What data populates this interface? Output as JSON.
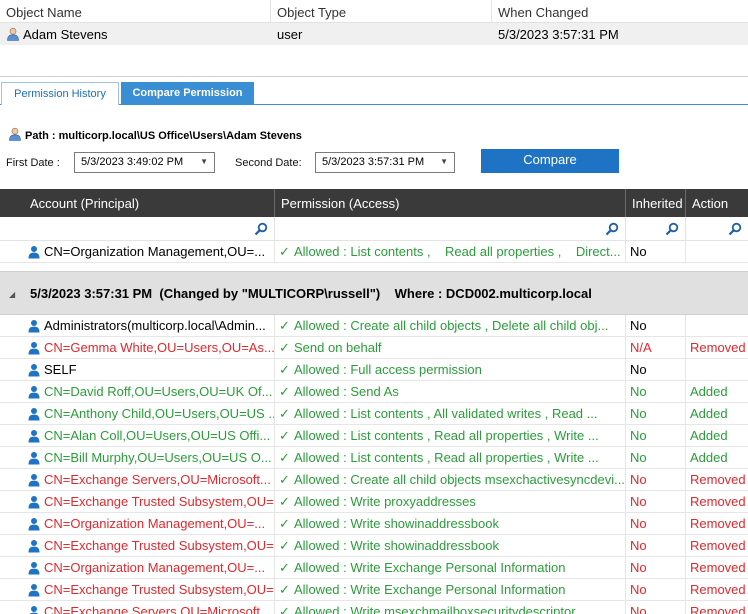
{
  "top_grid": {
    "headers": [
      "Object Name",
      "Object Type",
      "When Changed"
    ],
    "row": {
      "name": "Adam Stevens",
      "type": "user",
      "when": "5/3/2023 3:57:31 PM"
    }
  },
  "tabs": [
    {
      "label": "Permission History",
      "active": false
    },
    {
      "label": "Compare Permission",
      "active": true
    }
  ],
  "path": "Path : multicorp.local\\US Office\\Users\\Adam Stevens",
  "first_date": {
    "label": "First Date :",
    "value": "5/3/2023 3:49:02 PM"
  },
  "second_date": {
    "label": "Second Date:",
    "value": "5/3/2023 3:57:31 PM"
  },
  "compare_label": "Compare",
  "grid": {
    "headers": [
      "Account (Principal)",
      "Permission (Access)",
      "Inherited",
      "Action"
    ],
    "pre_rows": [
      {
        "account": "CN=Organization Management,OU=...",
        "perm_a": "Allowed : List contents ,",
        "perm_b": "Read all properties ,",
        "perm_c": "Direct...",
        "inherited": "No",
        "action": "",
        "color": "black"
      }
    ],
    "group_text": "5/3/2023 3:57:31 PM  (Changed by \"MULTICORP\\russell\")    Where : DCD002.multicorp.local",
    "rows": [
      {
        "account": "Administrators(multicorp.local\\Admin...",
        "perm": "Allowed : Create all child objects ,    Delete all child obj...",
        "inherited": "No",
        "action": "",
        "color": "black"
      },
      {
        "account": "CN=Gemma White,OU=Users,OU=As...",
        "perm": "Send on behalf",
        "inherited": "N/A",
        "action": "Removed",
        "color": "red"
      },
      {
        "account": "SELF",
        "perm": "Allowed : Full access permission",
        "inherited": "No",
        "action": "",
        "color": "black"
      },
      {
        "account": "CN=David Roff,OU=Users,OU=UK Of...",
        "perm": "Allowed : Send As",
        "inherited": "No",
        "action": "Added",
        "color": "green"
      },
      {
        "account": "CN=Anthony Child,OU=Users,OU=US ...",
        "perm": "Allowed : List contents ,    All validated writes ,    Read ...",
        "inherited": "No",
        "action": "Added",
        "color": "green"
      },
      {
        "account": "CN=Alan Coll,OU=Users,OU=US Offi...",
        "perm": "Allowed : List contents ,    Read all properties ,    Write ...",
        "inherited": "No",
        "action": "Added",
        "color": "green"
      },
      {
        "account": "CN=Bill Murphy,OU=Users,OU=US O...",
        "perm": "Allowed : List contents ,    Read all properties ,    Write ...",
        "inherited": "No",
        "action": "Added",
        "color": "green"
      },
      {
        "account": "CN=Exchange Servers,OU=Microsoft...",
        "perm": "Allowed : Create all child objects msexchactivesyncdevi...",
        "inherited": "No",
        "action": "Removed",
        "color": "red"
      },
      {
        "account": "CN=Exchange Trusted Subsystem,OU=...",
        "perm": "Allowed : Write   proxyaddresses",
        "inherited": "No",
        "action": "Removed",
        "color": "red"
      },
      {
        "account": "CN=Organization Management,OU=...",
        "perm": "Allowed : Write   showinaddressbook",
        "inherited": "No",
        "action": "Removed",
        "color": "red"
      },
      {
        "account": "CN=Exchange Trusted Subsystem,OU=...",
        "perm": "Allowed : Write   showinaddressbook",
        "inherited": "No",
        "action": "Removed",
        "color": "red"
      },
      {
        "account": "CN=Organization Management,OU=...",
        "perm": "Allowed : Write   Exchange Personal Information",
        "inherited": "No",
        "action": "Removed",
        "color": "red"
      },
      {
        "account": "CN=Exchange Trusted Subsystem,OU=...",
        "perm": "Allowed : Write   Exchange Personal Information",
        "inherited": "No",
        "action": "Removed",
        "color": "red"
      },
      {
        "account": "CN=Exchange Servers,OU=Microsoft...",
        "perm": "Allowed : Write   msexchmailboxsecuritydescriptor",
        "inherited": "No",
        "action": "Removed",
        "color": "red"
      }
    ]
  },
  "colors": {
    "accent": "#1f73c4",
    "tab_active": "#3a8ed3",
    "added": "#2a9d3a",
    "removed": "#e0282e",
    "header_bg": "#3a3a3a"
  },
  "icons": [
    "user-icon",
    "search-icon",
    "check-icon",
    "dropdown-caret-icon",
    "collapse-triangle-icon"
  ]
}
